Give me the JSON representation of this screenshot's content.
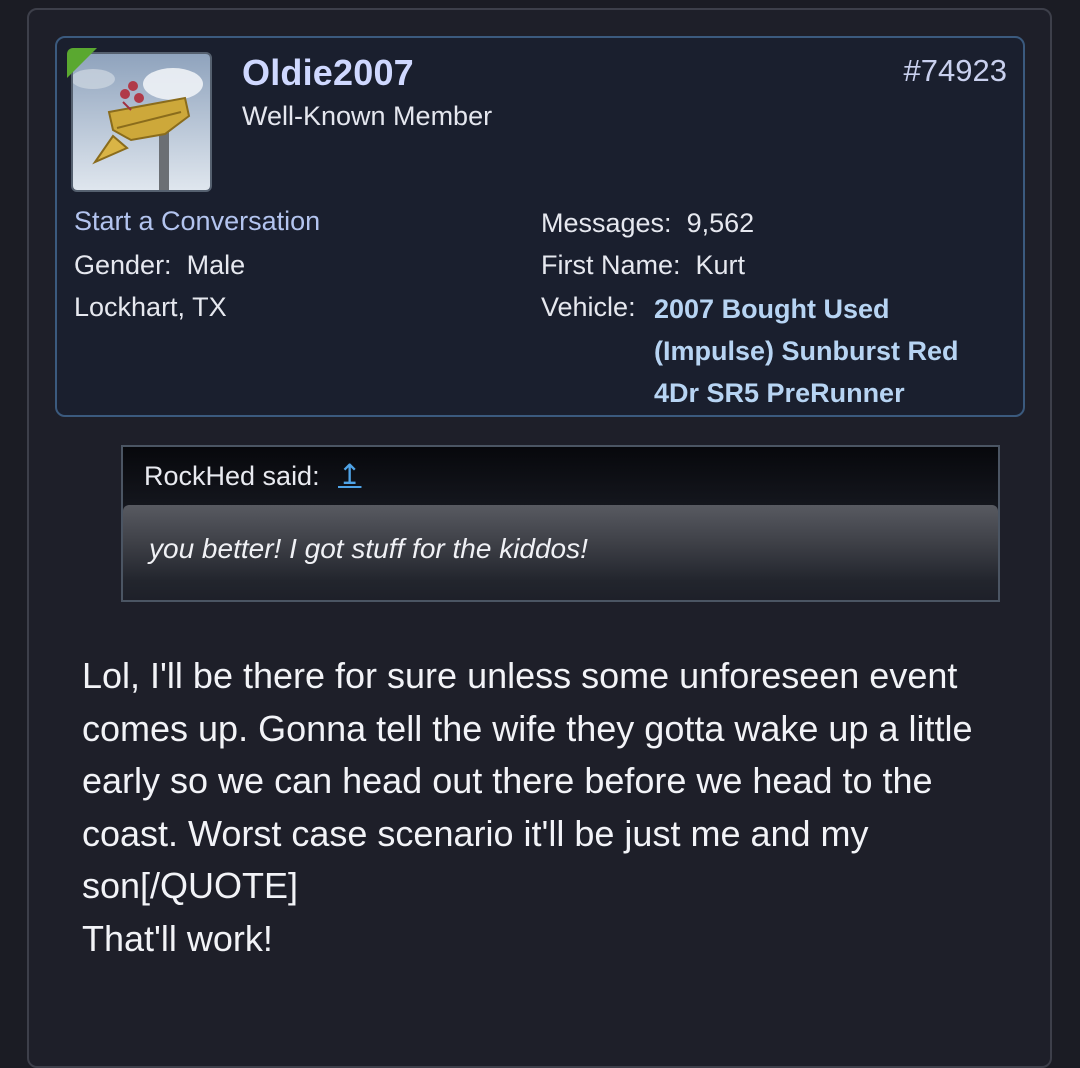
{
  "post": {
    "user": {
      "username": "Oldie2007",
      "title": "Well-Known Member",
      "start_conversation": "Start a Conversation",
      "gender_label": "Gender:",
      "gender_value": "Male",
      "location": "Lockhart, TX",
      "messages_label": "Messages:",
      "messages_value": "9,562",
      "first_name_label": "First Name:",
      "first_name_value": "Kurt",
      "vehicle_label": "Vehicle:",
      "vehicle_value": "2007 Bought Used (Impulse) Sunburst Red 4Dr SR5 PreRunner"
    },
    "post_number": "#74923",
    "quote": {
      "author": "RockHed said:",
      "jump_icon": "↥",
      "text": "you better! I got stuff for the kiddos!"
    },
    "body": {
      "paragraph": "Lol, I'll be there for sure unless some unforeseen event comes up. Gonna tell the wife they gotta wake up a little early so we can head out there before we head to the coast. Worst case scenario it'll be just me and my son[/QUOTE]",
      "closing": "That'll work!"
    }
  },
  "colors": {
    "background": "#1b1c24",
    "card_border": "#3b5a7e",
    "username": "#cfd8ff",
    "link": "#b3c4ef",
    "vehicle": "#b7d4f3",
    "online": "#5aa830",
    "quote_jump": "#4fa3e6"
  },
  "icons": {
    "avatar": "weather-vane-avatar",
    "online": "online-indicator-icon",
    "jump": "arrow-up-jump-icon"
  }
}
